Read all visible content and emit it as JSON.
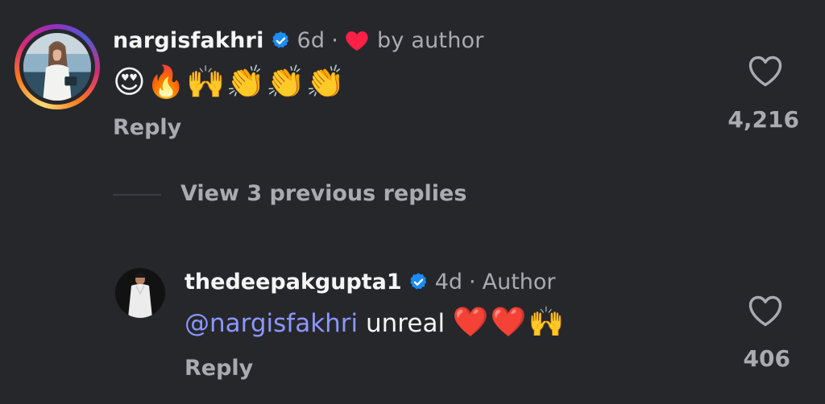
{
  "comment": {
    "username": "nargisfakhri",
    "time": "6d",
    "separator": "·",
    "liked_by": "by author",
    "text": "😍🔥🙌👏👏👏",
    "reply_label": "Reply",
    "like_count": "4,216"
  },
  "view_replies": "View 3 previous replies",
  "reply": {
    "username": "thedeepakgupta1",
    "time": "4d",
    "separator": "·",
    "badge": "Author",
    "mention": "@nargisfakhri",
    "text": "unreal",
    "emojis": "❤️❤️🙌",
    "reply_label": "Reply",
    "like_count": "406"
  },
  "colors": {
    "background": "#26272b",
    "verified": "#1d8cf5",
    "mention": "#8b97ff",
    "like_heart": "#ff2046",
    "muted_text": "#a9abb1"
  },
  "icons": {
    "verified": "verified-badge-icon",
    "author_like": "heart-filled-icon",
    "like": "heart-outline-icon"
  }
}
